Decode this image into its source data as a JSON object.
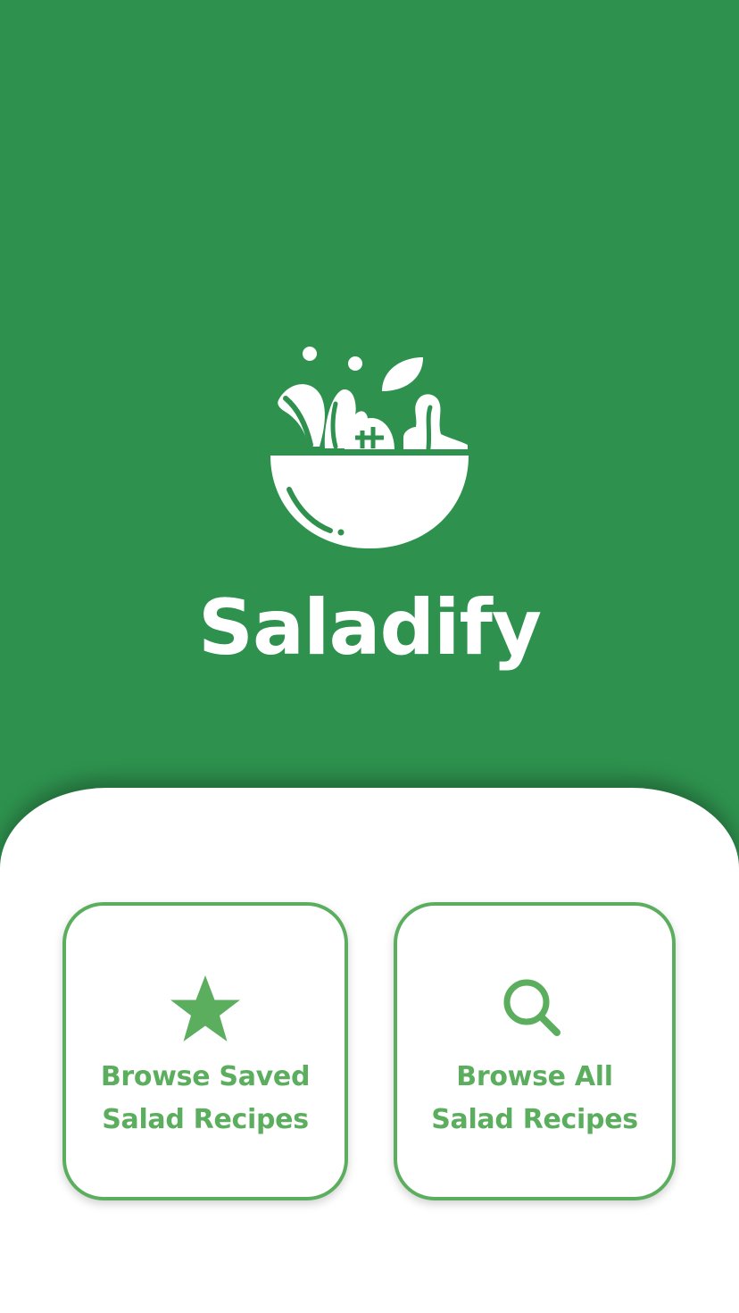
{
  "app": {
    "title": "Saladify",
    "logo": "salad-bowl-icon"
  },
  "colors": {
    "brand_green": "#2e924e",
    "accent_green": "#5cae5f",
    "sheet": "#ffffff"
  },
  "actions": [
    {
      "icon": "star-icon",
      "label_line1": "Browse Saved",
      "label_line2": "Salad Recipes"
    },
    {
      "icon": "search-icon",
      "label_line1": "Browse All",
      "label_line2": "Salad Recipes"
    }
  ]
}
